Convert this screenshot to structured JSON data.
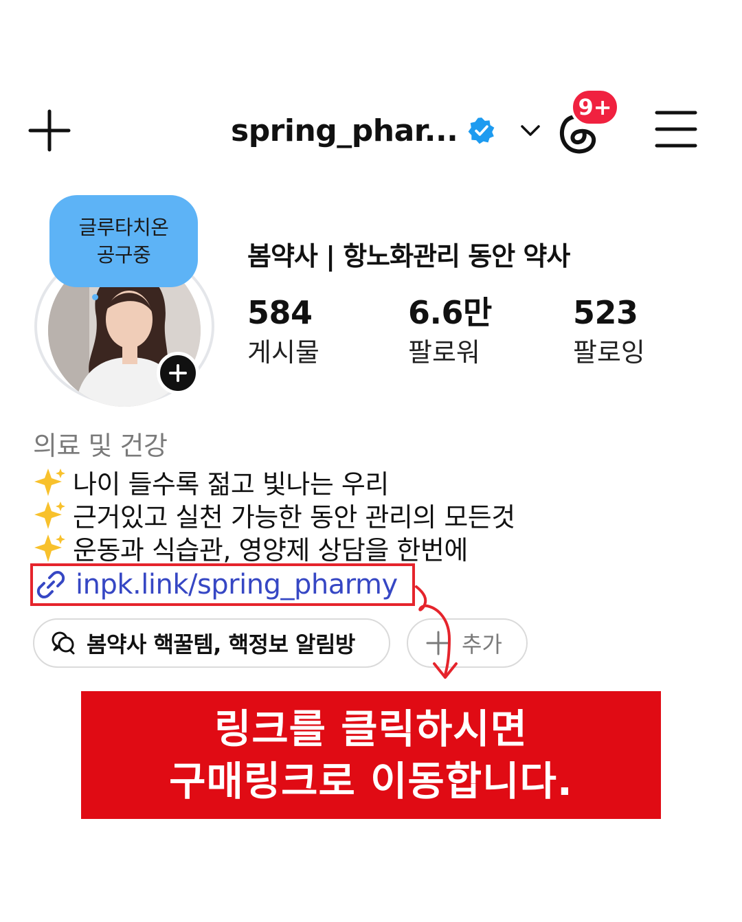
{
  "header": {
    "username": "spring_phar...",
    "notification_badge": "9+"
  },
  "profile": {
    "note": [
      "글루타치온",
      "공구중"
    ],
    "display_name": "봄약사 | 항노화관리 동안 약사",
    "stats": [
      {
        "value": "584",
        "label": "게시물"
      },
      {
        "value": "6.6만",
        "label": "팔로워"
      },
      {
        "value": "523",
        "label": "팔로잉"
      }
    ],
    "category": "의료 및 건강",
    "bio": [
      "나이 들수록 젊고 빛나는 우리",
      "근거있고 실천 가능한 동안 관리의 모든것",
      "운동과 식습관, 영양제 상담을 한번에"
    ],
    "link": "inpk.link/spring_pharmy"
  },
  "chips": {
    "channel": "봄약사 핵꿀템, 핵정보 알림방",
    "add": "추가"
  },
  "annotation": {
    "banner": [
      "링크를 클릭하시면",
      "구매링크로 이동합니다."
    ],
    "highlight_color": "#e5242c",
    "banner_color": "#e00b14"
  },
  "colors": {
    "verified": "#1d9bf0",
    "note_bubble": "#5db3f6",
    "link": "#3647c4",
    "badge": "#f0213f"
  },
  "icons": [
    "plus-icon",
    "verified-badge-icon",
    "chevron-down-icon",
    "threads-icon",
    "menu-icon",
    "sparkles-icon",
    "link-icon",
    "chat-bubbles-icon",
    "add-icon"
  ]
}
